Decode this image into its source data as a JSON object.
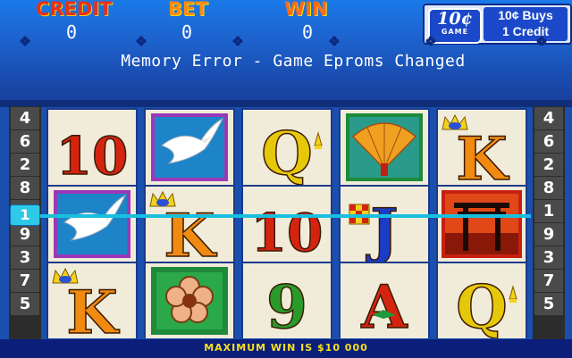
{
  "header": {
    "credit_label": "CREDIT",
    "credit_value": "0",
    "bet_label": "BET",
    "bet_value": "0",
    "win_label": "WIN",
    "win_value": "0",
    "denomination_badge": "10¢",
    "denomination_badge_sub": "GAME",
    "denomination_text_1": "10¢ Buys",
    "denomination_text_2": "1 Credit"
  },
  "message": "Memory Error - Game Eproms Changed",
  "paytable_left": [
    "4",
    "6",
    "2",
    "8",
    "1",
    "9",
    "3",
    "7",
    "5"
  ],
  "paytable_right": [
    "4",
    "6",
    "2",
    "8",
    "1",
    "9",
    "3",
    "7",
    "5"
  ],
  "payline": {
    "label": "1"
  },
  "reels": [
    [
      "ten",
      "bird",
      "king"
    ],
    [
      "bird",
      "king",
      "flower"
    ],
    [
      "queen",
      "ten",
      "nine"
    ],
    [
      "fan",
      "jack",
      "ace"
    ],
    [
      "king",
      "gate",
      "queen"
    ]
  ],
  "symbol_text": {
    "ten": "10",
    "nine": "9",
    "jack": "J",
    "queen": "Q",
    "king": "K",
    "ace": "A"
  },
  "footer": {
    "max_win": "MAXIMUM WIN IS $10 000"
  },
  "colors": {
    "background": "#1a4fae",
    "payline": "#18c0e0",
    "reel_bg": "#f1ecd9",
    "max_win": "#f7e020"
  }
}
